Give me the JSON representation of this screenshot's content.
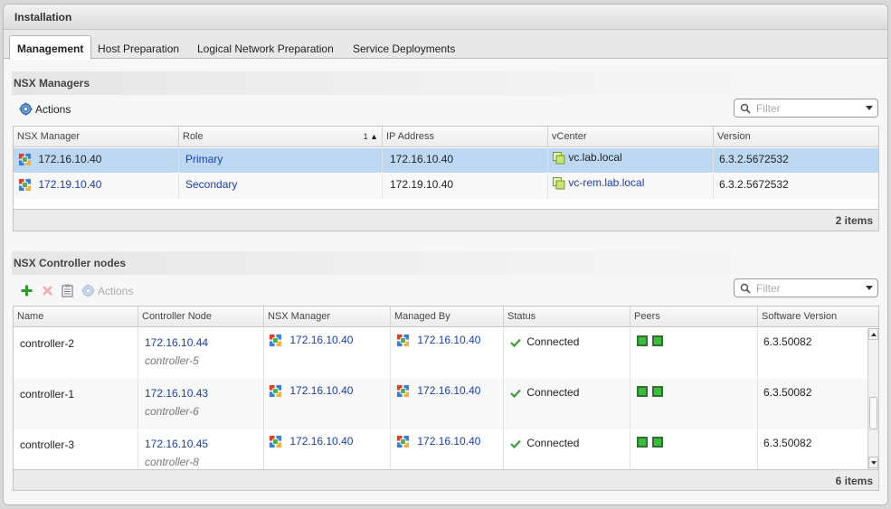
{
  "window": {
    "title": "Installation"
  },
  "tabs": [
    {
      "label": "Management"
    },
    {
      "label": "Host Preparation"
    },
    {
      "label": "Logical Network Preparation"
    },
    {
      "label": "Service Deployments"
    }
  ],
  "managers": {
    "title": "NSX Managers",
    "actions_label": "Actions",
    "filter_placeholder": "Filter",
    "columns": [
      "NSX Manager",
      "Role",
      "IP Address",
      "vCenter",
      "Version"
    ],
    "sort_indicator": "1 ▲",
    "rows": [
      {
        "manager": "172.16.10.40",
        "role": "Primary",
        "ip": "172.16.10.40",
        "vcenter": "vc.lab.local",
        "version": "6.3.2.5672532"
      },
      {
        "manager": "172.19.10.40",
        "role": "Secondary",
        "ip": "172.19.10.40",
        "vcenter": "vc-rem.lab.local",
        "version": "6.3.2.5672532"
      }
    ],
    "footer": "2 items"
  },
  "controllers": {
    "title": "NSX Controller nodes",
    "actions_label": "Actions",
    "filter_placeholder": "Filter",
    "columns": [
      "Name",
      "Controller Node",
      "NSX Manager",
      "Managed By",
      "Status",
      "Peers",
      "Software Version"
    ],
    "rows": [
      {
        "name": "controller-2",
        "node_ip": "172.16.10.44",
        "node_id": "controller-5",
        "manager": "172.16.10.40",
        "managed_by": "172.16.10.40",
        "status": "Connected",
        "version": "6.3.50082"
      },
      {
        "name": "controller-1",
        "node_ip": "172.16.10.43",
        "node_id": "controller-6",
        "manager": "172.16.10.40",
        "managed_by": "172.16.10.40",
        "status": "Connected",
        "version": "6.3.50082"
      },
      {
        "name": "controller-3",
        "node_ip": "172.16.10.45",
        "node_id": "controller-8",
        "manager": "172.16.10.40",
        "managed_by": "172.16.10.40",
        "status": "Connected",
        "version": "6.3.50082"
      }
    ],
    "footer": "6 items"
  },
  "icons": {
    "manager": "nsx-manager-icon",
    "vcenter": "vcenter-icon",
    "add": "add-icon",
    "delete": "delete-icon",
    "clipboard": "clipboard-icon",
    "gear": "gear-icon",
    "search": "search-icon",
    "status": "check-icon",
    "peer": "peer-status-icon"
  },
  "colors": {
    "selected_row": "#bcd8f3",
    "link": "#1a3fa8",
    "status_ok": "#3c9a3c"
  }
}
